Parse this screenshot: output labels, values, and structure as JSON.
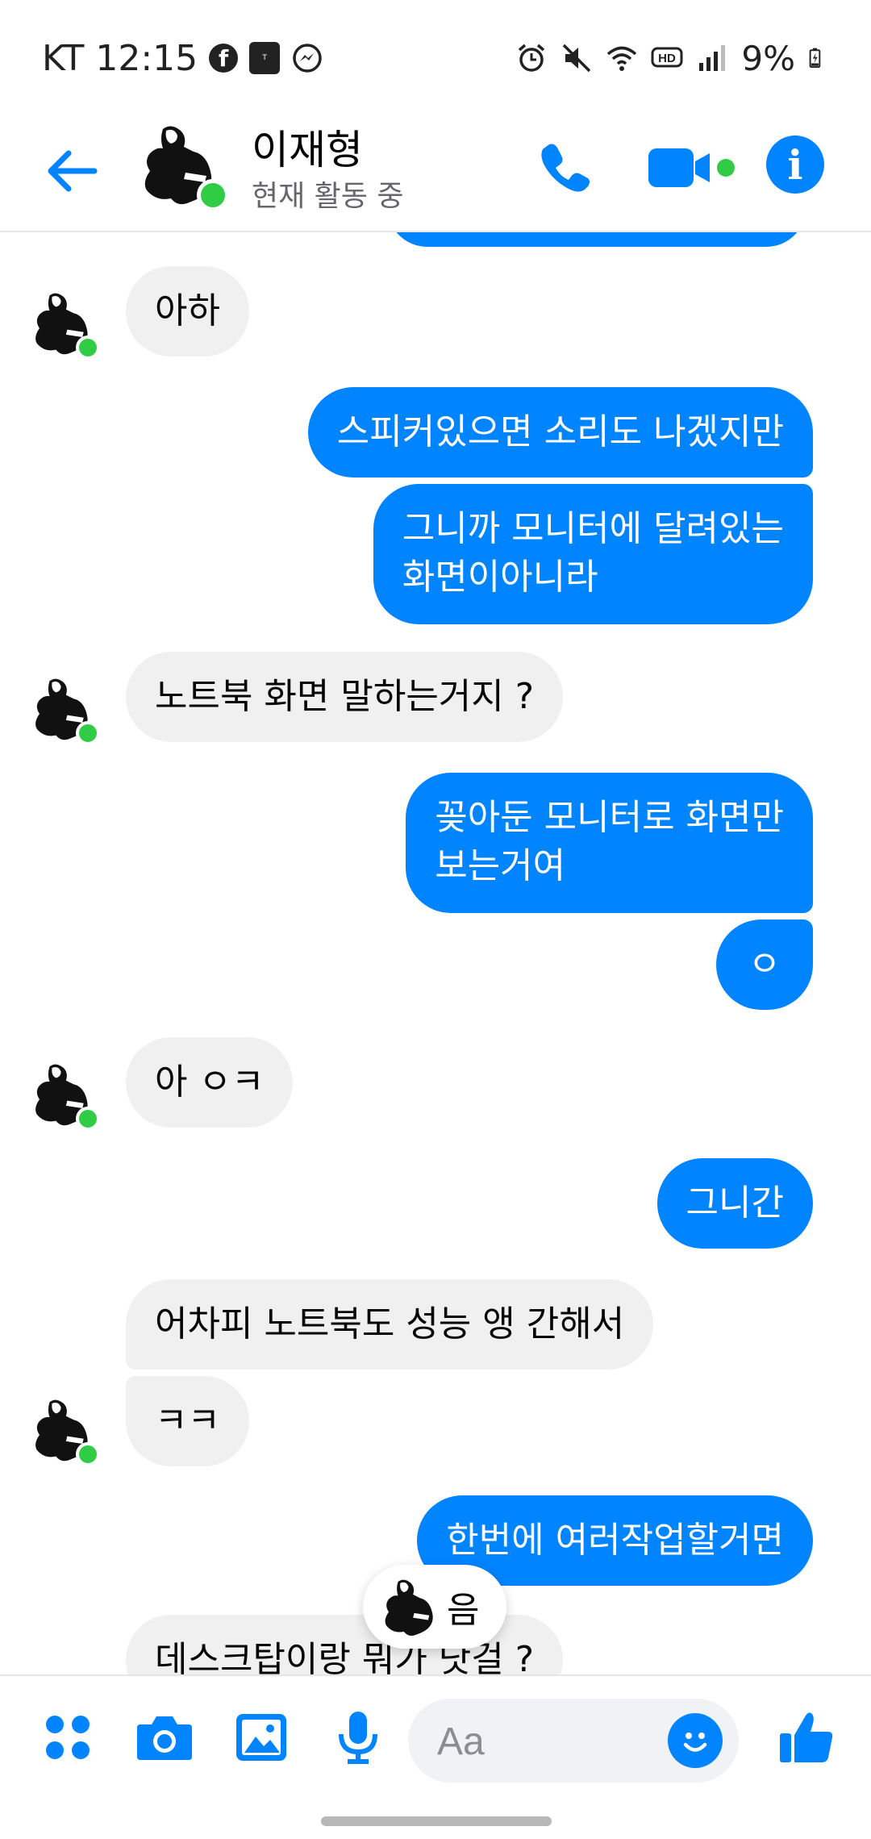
{
  "status_bar": {
    "carrier": "KT",
    "time": "12:15",
    "battery": "9%",
    "app_icons": [
      "facebook-icon",
      "tmoney-icon",
      "messenger-icon"
    ],
    "system_icons": [
      "alarm-icon",
      "mute-icon",
      "wifi-icon",
      "hd-icon",
      "signal-icon",
      "battery-charging-icon"
    ]
  },
  "header": {
    "contact_name": "이재형",
    "status": "현재 활동 중",
    "accent_color": "#0084ff",
    "online_color": "#31cc46"
  },
  "messages": [
    {
      "dir": "in",
      "text": "아하",
      "avatar": true
    },
    {
      "dir": "out",
      "text": "스피커있으면 소리도 나겠지만"
    },
    {
      "dir": "out",
      "text": "그니까 모니터에 달려있는\n화면이아니라"
    },
    {
      "dir": "in",
      "text": "노트북 화면 말하는거지 ?",
      "avatar": true
    },
    {
      "dir": "out",
      "text": "꽂아둔 모니터로 화면만\n보는거여"
    },
    {
      "dir": "out",
      "text": "ㅇ"
    },
    {
      "dir": "in",
      "text": "아 ㅇㅋ",
      "avatar": true
    },
    {
      "dir": "out",
      "text": "그니간"
    },
    {
      "dir": "in",
      "text": "어차피 노트북도 성능 앵 간해서"
    },
    {
      "dir": "in",
      "text": "ㅋㅋ",
      "avatar": true
    },
    {
      "dir": "out",
      "text": "한번에 여러작업할거면"
    },
    {
      "dir": "in",
      "text": "데스크탑이랑 뭐가 낫걸 ?"
    }
  ],
  "typing_indicator": {
    "text": "음"
  },
  "composer": {
    "placeholder": "Aa"
  },
  "bottom_icons": [
    "apps-icon",
    "camera-icon",
    "gallery-icon",
    "microphone-icon",
    "emoji-icon",
    "thumbs-up-icon"
  ]
}
